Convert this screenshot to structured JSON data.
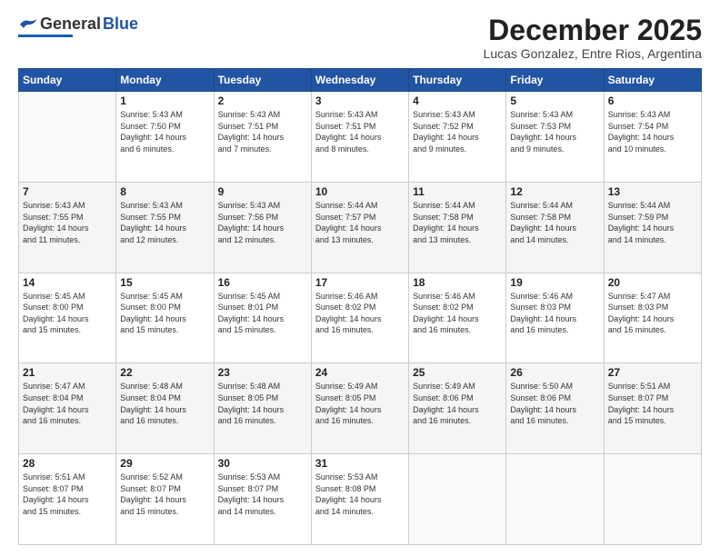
{
  "header": {
    "logo_general": "General",
    "logo_blue": "Blue",
    "month_title": "December 2025",
    "location": "Lucas Gonzalez, Entre Rios, Argentina"
  },
  "weekdays": [
    "Sunday",
    "Monday",
    "Tuesday",
    "Wednesday",
    "Thursday",
    "Friday",
    "Saturday"
  ],
  "weeks": [
    [
      {
        "day": "",
        "info": ""
      },
      {
        "day": "1",
        "info": "Sunrise: 5:43 AM\nSunset: 7:50 PM\nDaylight: 14 hours\nand 6 minutes."
      },
      {
        "day": "2",
        "info": "Sunrise: 5:43 AM\nSunset: 7:51 PM\nDaylight: 14 hours\nand 7 minutes."
      },
      {
        "day": "3",
        "info": "Sunrise: 5:43 AM\nSunset: 7:51 PM\nDaylight: 14 hours\nand 8 minutes."
      },
      {
        "day": "4",
        "info": "Sunrise: 5:43 AM\nSunset: 7:52 PM\nDaylight: 14 hours\nand 9 minutes."
      },
      {
        "day": "5",
        "info": "Sunrise: 5:43 AM\nSunset: 7:53 PM\nDaylight: 14 hours\nand 9 minutes."
      },
      {
        "day": "6",
        "info": "Sunrise: 5:43 AM\nSunset: 7:54 PM\nDaylight: 14 hours\nand 10 minutes."
      }
    ],
    [
      {
        "day": "7",
        "info": "Sunrise: 5:43 AM\nSunset: 7:55 PM\nDaylight: 14 hours\nand 11 minutes."
      },
      {
        "day": "8",
        "info": "Sunrise: 5:43 AM\nSunset: 7:55 PM\nDaylight: 14 hours\nand 12 minutes."
      },
      {
        "day": "9",
        "info": "Sunrise: 5:43 AM\nSunset: 7:56 PM\nDaylight: 14 hours\nand 12 minutes."
      },
      {
        "day": "10",
        "info": "Sunrise: 5:44 AM\nSunset: 7:57 PM\nDaylight: 14 hours\nand 13 minutes."
      },
      {
        "day": "11",
        "info": "Sunrise: 5:44 AM\nSunset: 7:58 PM\nDaylight: 14 hours\nand 13 minutes."
      },
      {
        "day": "12",
        "info": "Sunrise: 5:44 AM\nSunset: 7:58 PM\nDaylight: 14 hours\nand 14 minutes."
      },
      {
        "day": "13",
        "info": "Sunrise: 5:44 AM\nSunset: 7:59 PM\nDaylight: 14 hours\nand 14 minutes."
      }
    ],
    [
      {
        "day": "14",
        "info": "Sunrise: 5:45 AM\nSunset: 8:00 PM\nDaylight: 14 hours\nand 15 minutes."
      },
      {
        "day": "15",
        "info": "Sunrise: 5:45 AM\nSunset: 8:00 PM\nDaylight: 14 hours\nand 15 minutes."
      },
      {
        "day": "16",
        "info": "Sunrise: 5:45 AM\nSunset: 8:01 PM\nDaylight: 14 hours\nand 15 minutes."
      },
      {
        "day": "17",
        "info": "Sunrise: 5:46 AM\nSunset: 8:02 PM\nDaylight: 14 hours\nand 16 minutes."
      },
      {
        "day": "18",
        "info": "Sunrise: 5:46 AM\nSunset: 8:02 PM\nDaylight: 14 hours\nand 16 minutes."
      },
      {
        "day": "19",
        "info": "Sunrise: 5:46 AM\nSunset: 8:03 PM\nDaylight: 14 hours\nand 16 minutes."
      },
      {
        "day": "20",
        "info": "Sunrise: 5:47 AM\nSunset: 8:03 PM\nDaylight: 14 hours\nand 16 minutes."
      }
    ],
    [
      {
        "day": "21",
        "info": "Sunrise: 5:47 AM\nSunset: 8:04 PM\nDaylight: 14 hours\nand 16 minutes."
      },
      {
        "day": "22",
        "info": "Sunrise: 5:48 AM\nSunset: 8:04 PM\nDaylight: 14 hours\nand 16 minutes."
      },
      {
        "day": "23",
        "info": "Sunrise: 5:48 AM\nSunset: 8:05 PM\nDaylight: 14 hours\nand 16 minutes."
      },
      {
        "day": "24",
        "info": "Sunrise: 5:49 AM\nSunset: 8:05 PM\nDaylight: 14 hours\nand 16 minutes."
      },
      {
        "day": "25",
        "info": "Sunrise: 5:49 AM\nSunset: 8:06 PM\nDaylight: 14 hours\nand 16 minutes."
      },
      {
        "day": "26",
        "info": "Sunrise: 5:50 AM\nSunset: 8:06 PM\nDaylight: 14 hours\nand 16 minutes."
      },
      {
        "day": "27",
        "info": "Sunrise: 5:51 AM\nSunset: 8:07 PM\nDaylight: 14 hours\nand 15 minutes."
      }
    ],
    [
      {
        "day": "28",
        "info": "Sunrise: 5:51 AM\nSunset: 8:07 PM\nDaylight: 14 hours\nand 15 minutes."
      },
      {
        "day": "29",
        "info": "Sunrise: 5:52 AM\nSunset: 8:07 PM\nDaylight: 14 hours\nand 15 minutes."
      },
      {
        "day": "30",
        "info": "Sunrise: 5:53 AM\nSunset: 8:07 PM\nDaylight: 14 hours\nand 14 minutes."
      },
      {
        "day": "31",
        "info": "Sunrise: 5:53 AM\nSunset: 8:08 PM\nDaylight: 14 hours\nand 14 minutes."
      },
      {
        "day": "",
        "info": ""
      },
      {
        "day": "",
        "info": ""
      },
      {
        "day": "",
        "info": ""
      }
    ]
  ]
}
